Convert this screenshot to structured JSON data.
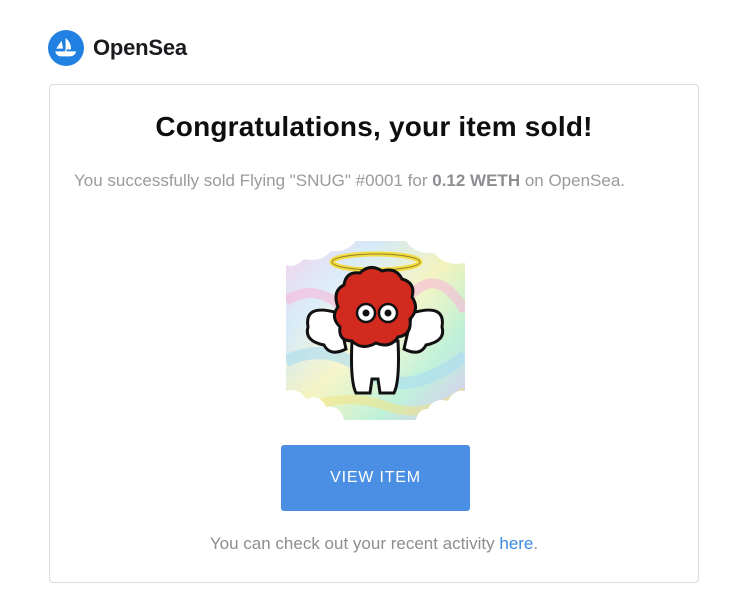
{
  "header": {
    "brand": "OpenSea",
    "logo_icon": "opensea-logo-icon",
    "accent": "#2081e2"
  },
  "email": {
    "title": "Congratulations, your item sold!",
    "message": {
      "prefix": "You successfully sold Flying \"SNUG\" #0001 for ",
      "amount": "0.12 WETH",
      "suffix": " on OpenSea."
    },
    "item_image_icon": "snug-angel-nft-image",
    "cta_label": "VIEW ITEM",
    "cta_color": "#4a8fe3",
    "footer": {
      "prefix": "You can check out your recent activity ",
      "link": "here",
      "suffix": "."
    }
  }
}
